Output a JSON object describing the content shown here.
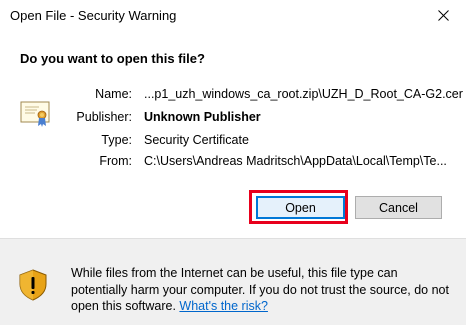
{
  "window": {
    "title": "Open File - Security Warning",
    "close_glyph": "✕"
  },
  "dialog": {
    "heading": "Do you want to open this file?",
    "icon": "certificate-icon",
    "fields": [
      {
        "label": "Name:",
        "value": "...p1_uzh_windows_ca_root.zip\\UZH_D_Root_CA-G2.cer",
        "bold": false
      },
      {
        "label": "Publisher:",
        "value": "Unknown Publisher",
        "bold": true
      },
      {
        "label": "Type:",
        "value": "Security Certificate",
        "bold": false
      },
      {
        "label": "From:",
        "value": "C:\\Users\\Andreas Madritsch\\AppData\\Local\\Temp\\Te...",
        "bold": false
      }
    ]
  },
  "buttons": {
    "open_label": "Open",
    "cancel_label": "Cancel"
  },
  "footer": {
    "icon": "shield-warning-icon",
    "warning_text": "While files from the Internet can be useful, this file type can potentially harm your computer. If you do not trust the source, do not open this software.",
    "link_text": "What's the risk?"
  },
  "colors": {
    "highlight": "#e8001c",
    "link": "#0066cc",
    "accent": "#0078d7"
  }
}
